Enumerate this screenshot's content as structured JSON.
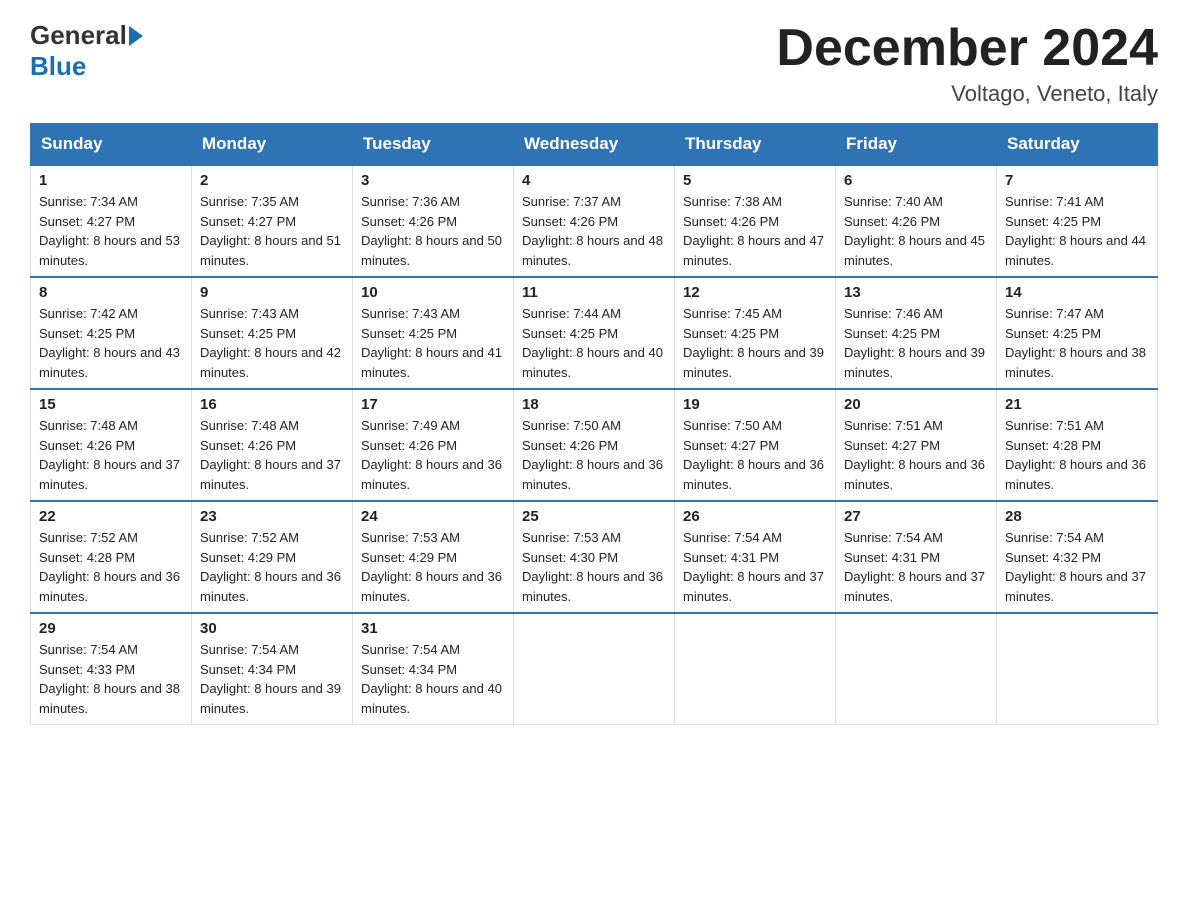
{
  "header": {
    "logo_general": "General",
    "logo_blue": "Blue",
    "title": "December 2024",
    "location": "Voltago, Veneto, Italy"
  },
  "weekdays": [
    "Sunday",
    "Monday",
    "Tuesday",
    "Wednesday",
    "Thursday",
    "Friday",
    "Saturday"
  ],
  "weeks": [
    [
      {
        "day": "1",
        "sunrise": "7:34 AM",
        "sunset": "4:27 PM",
        "daylight": "8 hours and 53 minutes."
      },
      {
        "day": "2",
        "sunrise": "7:35 AM",
        "sunset": "4:27 PM",
        "daylight": "8 hours and 51 minutes."
      },
      {
        "day": "3",
        "sunrise": "7:36 AM",
        "sunset": "4:26 PM",
        "daylight": "8 hours and 50 minutes."
      },
      {
        "day": "4",
        "sunrise": "7:37 AM",
        "sunset": "4:26 PM",
        "daylight": "8 hours and 48 minutes."
      },
      {
        "day": "5",
        "sunrise": "7:38 AM",
        "sunset": "4:26 PM",
        "daylight": "8 hours and 47 minutes."
      },
      {
        "day": "6",
        "sunrise": "7:40 AM",
        "sunset": "4:26 PM",
        "daylight": "8 hours and 45 minutes."
      },
      {
        "day": "7",
        "sunrise": "7:41 AM",
        "sunset": "4:25 PM",
        "daylight": "8 hours and 44 minutes."
      }
    ],
    [
      {
        "day": "8",
        "sunrise": "7:42 AM",
        "sunset": "4:25 PM",
        "daylight": "8 hours and 43 minutes."
      },
      {
        "day": "9",
        "sunrise": "7:43 AM",
        "sunset": "4:25 PM",
        "daylight": "8 hours and 42 minutes."
      },
      {
        "day": "10",
        "sunrise": "7:43 AM",
        "sunset": "4:25 PM",
        "daylight": "8 hours and 41 minutes."
      },
      {
        "day": "11",
        "sunrise": "7:44 AM",
        "sunset": "4:25 PM",
        "daylight": "8 hours and 40 minutes."
      },
      {
        "day": "12",
        "sunrise": "7:45 AM",
        "sunset": "4:25 PM",
        "daylight": "8 hours and 39 minutes."
      },
      {
        "day": "13",
        "sunrise": "7:46 AM",
        "sunset": "4:25 PM",
        "daylight": "8 hours and 39 minutes."
      },
      {
        "day": "14",
        "sunrise": "7:47 AM",
        "sunset": "4:25 PM",
        "daylight": "8 hours and 38 minutes."
      }
    ],
    [
      {
        "day": "15",
        "sunrise": "7:48 AM",
        "sunset": "4:26 PM",
        "daylight": "8 hours and 37 minutes."
      },
      {
        "day": "16",
        "sunrise": "7:48 AM",
        "sunset": "4:26 PM",
        "daylight": "8 hours and 37 minutes."
      },
      {
        "day": "17",
        "sunrise": "7:49 AM",
        "sunset": "4:26 PM",
        "daylight": "8 hours and 36 minutes."
      },
      {
        "day": "18",
        "sunrise": "7:50 AM",
        "sunset": "4:26 PM",
        "daylight": "8 hours and 36 minutes."
      },
      {
        "day": "19",
        "sunrise": "7:50 AM",
        "sunset": "4:27 PM",
        "daylight": "8 hours and 36 minutes."
      },
      {
        "day": "20",
        "sunrise": "7:51 AM",
        "sunset": "4:27 PM",
        "daylight": "8 hours and 36 minutes."
      },
      {
        "day": "21",
        "sunrise": "7:51 AM",
        "sunset": "4:28 PM",
        "daylight": "8 hours and 36 minutes."
      }
    ],
    [
      {
        "day": "22",
        "sunrise": "7:52 AM",
        "sunset": "4:28 PM",
        "daylight": "8 hours and 36 minutes."
      },
      {
        "day": "23",
        "sunrise": "7:52 AM",
        "sunset": "4:29 PM",
        "daylight": "8 hours and 36 minutes."
      },
      {
        "day": "24",
        "sunrise": "7:53 AM",
        "sunset": "4:29 PM",
        "daylight": "8 hours and 36 minutes."
      },
      {
        "day": "25",
        "sunrise": "7:53 AM",
        "sunset": "4:30 PM",
        "daylight": "8 hours and 36 minutes."
      },
      {
        "day": "26",
        "sunrise": "7:54 AM",
        "sunset": "4:31 PM",
        "daylight": "8 hours and 37 minutes."
      },
      {
        "day": "27",
        "sunrise": "7:54 AM",
        "sunset": "4:31 PM",
        "daylight": "8 hours and 37 minutes."
      },
      {
        "day": "28",
        "sunrise": "7:54 AM",
        "sunset": "4:32 PM",
        "daylight": "8 hours and 37 minutes."
      }
    ],
    [
      {
        "day": "29",
        "sunrise": "7:54 AM",
        "sunset": "4:33 PM",
        "daylight": "8 hours and 38 minutes."
      },
      {
        "day": "30",
        "sunrise": "7:54 AM",
        "sunset": "4:34 PM",
        "daylight": "8 hours and 39 minutes."
      },
      {
        "day": "31",
        "sunrise": "7:54 AM",
        "sunset": "4:34 PM",
        "daylight": "8 hours and 40 minutes."
      },
      null,
      null,
      null,
      null
    ]
  ]
}
